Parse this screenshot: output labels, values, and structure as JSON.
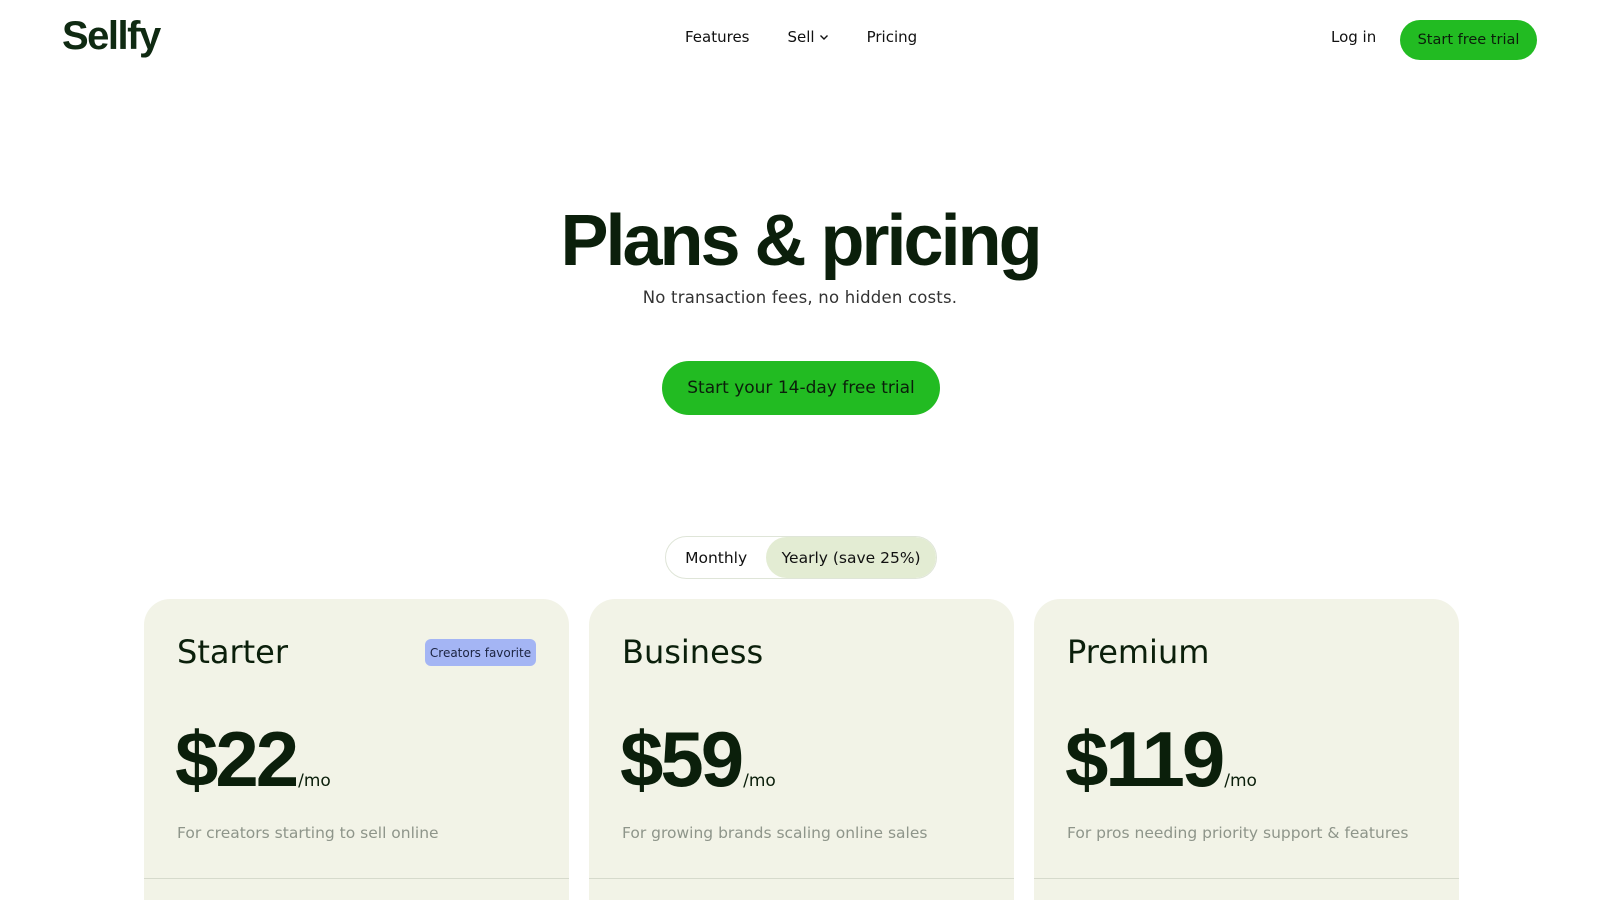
{
  "brand": {
    "logo_text": "Sellfy"
  },
  "nav": {
    "items": [
      {
        "label": "Features"
      },
      {
        "label": "Sell",
        "has_dropdown": true
      },
      {
        "label": "Pricing"
      }
    ],
    "login_label": "Log in",
    "cta_label": "Start free trial"
  },
  "hero": {
    "title": "Plans & pricing",
    "subtitle": "No transaction fees, no hidden costs.",
    "cta_label": "Start your 14-day free trial"
  },
  "billing_toggle": {
    "options": [
      "Monthly",
      "Yearly (save 25%)"
    ],
    "selected": "Yearly (save 25%)"
  },
  "plans": [
    {
      "name": "Starter",
      "badge": "Creators favorite",
      "price": "$22",
      "period": "/mo",
      "description": "For creators starting to sell online"
    },
    {
      "name": "Business",
      "price": "$59",
      "period": "/mo",
      "description": "For growing brands scaling online sales"
    },
    {
      "name": "Premium",
      "price": "$119",
      "period": "/mo",
      "description": "For pros needing priority support & features"
    }
  ],
  "colors": {
    "accent_green": "#22bb22",
    "dark_text": "#0b1f0b",
    "card_bg": "#f2f3e7",
    "toggle_selected_bg": "#e3ecd3",
    "badge_bg": "#a4b5f4"
  }
}
